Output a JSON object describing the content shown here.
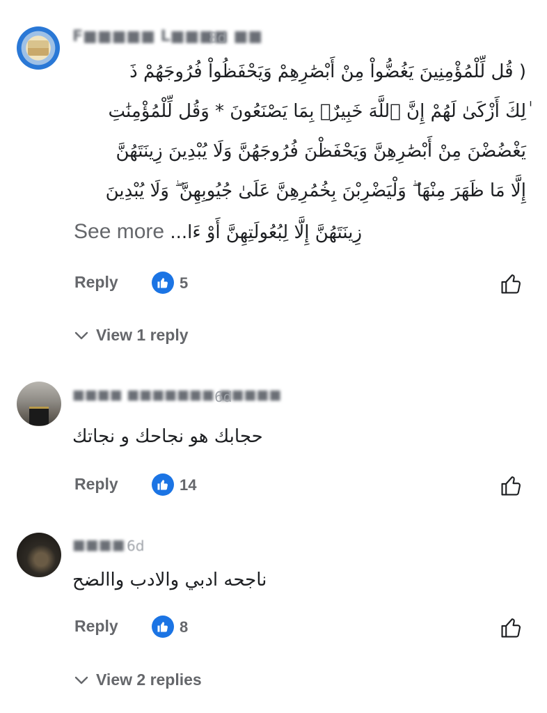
{
  "comments": [
    {
      "author": "F■■■■■ L■■■■ ■■",
      "time": "8d",
      "body_lines": [
        "( قُل لِّلْمُؤْمِنِينَ يَغُضُّواْ مِنْ أَبْصَٰرِهِمْ وَيَحْفَظُواْ فُرُوجَهُمْ ذَ",
        "ٰلِكَ أَزْكَىٰ لَهُمْ إِنَّ ٱللَّهَ خَبِيرٌۢ بِمَا يَصْنَعُونَ * وَقُل لِّلْمُؤْمِنَٰتِ",
        "يَغْضُضْنَ مِنْ أَبْصَٰرِهِنَّ وَيَحْفَظْنَ فُرُوجَهُنَّ وَلَا يُبْدِينَ زِينَتَهُنَّ",
        "إِلَّا مَا ظَهَرَ مِنْهَا ۖ وَلْيَضْرِبْنَ بِخُمُرِهِنَّ عَلَىٰ جُيُوبِهِنَّ ۖ وَلَا يُبْدِينَ"
      ],
      "truncated_line": "زِينَتَهُنَّ إِلَّا لِبُعُولَتِهِنَّ أَوْ ءَا...",
      "see_more": "See more",
      "reply": "Reply",
      "likes": "5",
      "view_replies": "View 1 reply"
    },
    {
      "author": "■■■■ ■■■■■■■ ■■■■■",
      "time": "6d",
      "body": "حجابك هو نجاحك و نجاتك",
      "reply": "Reply",
      "likes": "14"
    },
    {
      "author": "■■■■",
      "time": "6d",
      "body": "ناجحه ادبي والادب واالضح",
      "reply": "Reply",
      "likes": "8",
      "view_replies": "View 2 replies"
    }
  ],
  "icons": {
    "like_badge": "thumbs-up-icon",
    "like_button": "thumbs-up-outline-icon",
    "chevron": "chevron-down-icon"
  },
  "colors": {
    "accent": "#1b74e4",
    "secondary_text": "#65676b"
  }
}
